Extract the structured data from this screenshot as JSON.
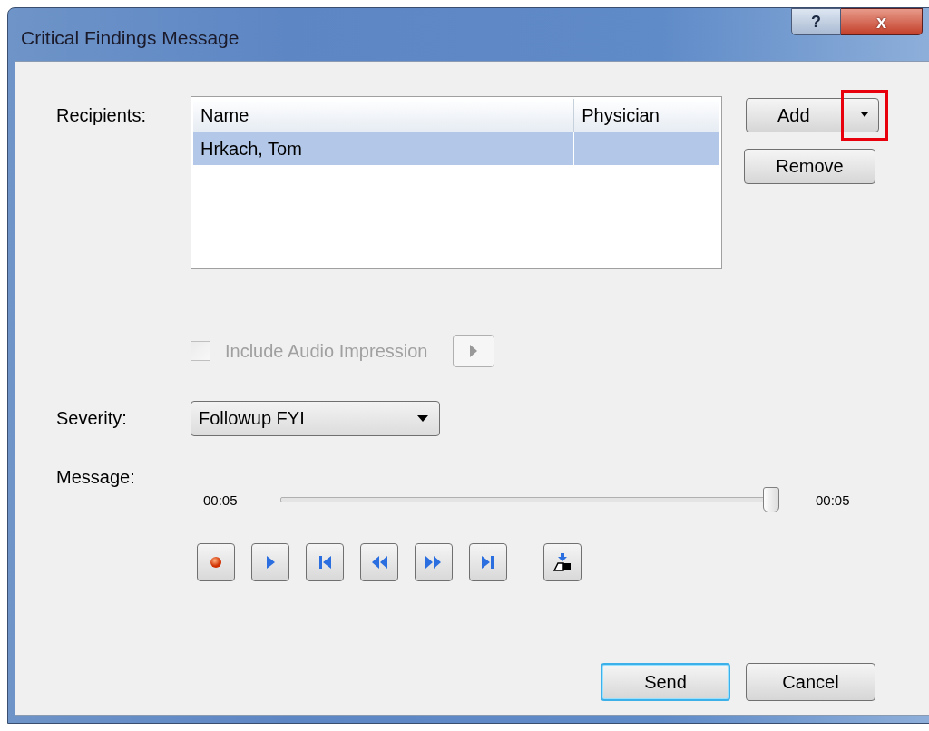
{
  "window": {
    "title": "Critical Findings Message",
    "help_button": "?",
    "close_button": "x"
  },
  "recipients": {
    "label": "Recipients:",
    "columns": [
      "Name",
      "Physician"
    ],
    "rows": [
      {
        "name": "Hrkach, Tom",
        "physician": "",
        "selected": true
      }
    ],
    "add_button": {
      "label": "Add",
      "highlighted": true
    },
    "remove_button": {
      "label": "Remove"
    }
  },
  "audio_impression": {
    "label": "Include Audio Impression",
    "checked": false,
    "disabled": true
  },
  "severity": {
    "label": "Severity:",
    "value": "Followup FYI"
  },
  "message": {
    "label": "Message:",
    "time_start": "00:05",
    "time_end": "00:05",
    "level": 1.0,
    "controls": [
      {
        "kind": "record"
      },
      {
        "kind": "play"
      },
      {
        "kind": "start"
      },
      {
        "kind": "rewind"
      },
      {
        "kind": "forward"
      },
      {
        "kind": "end"
      },
      {
        "kind": "insert"
      }
    ]
  },
  "buttons": [
    {
      "label": "Send",
      "default": true
    },
    {
      "label": "Cancel",
      "default": false
    }
  ]
}
